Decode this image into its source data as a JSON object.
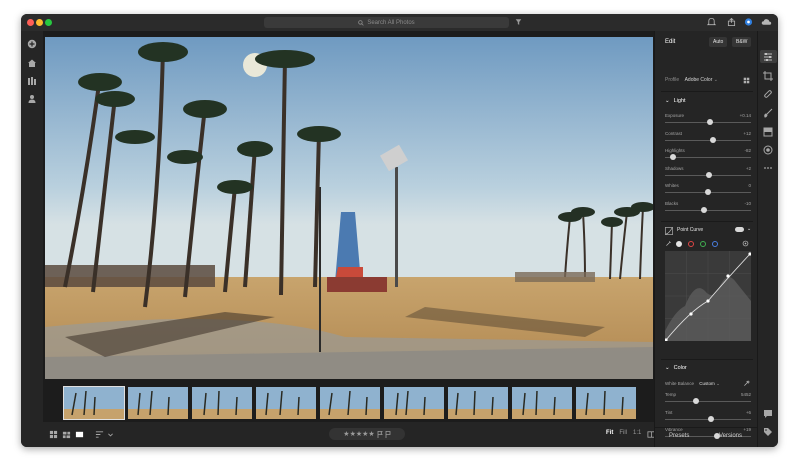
{
  "search": {
    "placeholder": "Search All Photos"
  },
  "edit_panel": {
    "title": "Edit",
    "auto_label": "Auto",
    "bw_label": "B&W",
    "profile_label": "Profile",
    "profile_value": "Adobe Color",
    "light_section": "Light",
    "light_sliders": [
      {
        "label": "Exposure",
        "value": "+0.14",
        "fraction": 0.52
      },
      {
        "label": "Contrast",
        "value": "+12",
        "fraction": 0.56
      },
      {
        "label": "Highlights",
        "value": "-82",
        "fraction": 0.09
      },
      {
        "label": "Shadows",
        "value": "+2",
        "fraction": 0.51
      },
      {
        "label": "Whites",
        "value": "0",
        "fraction": 0.5
      },
      {
        "label": "Blacks",
        "value": "-10",
        "fraction": 0.45
      }
    ],
    "point_curve_label": "Point Curve",
    "color_section": "Color",
    "white_balance_label": "White Balance",
    "white_balance_value": "Custom",
    "color_sliders": [
      {
        "label": "Temp",
        "value": "5452",
        "fraction": 0.36
      },
      {
        "label": "Tint",
        "value": "+6",
        "fraction": 0.53
      },
      {
        "label": "Vibrance",
        "value": "+19",
        "fraction": 0.6
      }
    ]
  },
  "bottom": {
    "fit_label": "Fit",
    "fill_label": "Fill",
    "one_to_one_label": "1:1",
    "presets_label": "Presets",
    "versions_label": "Versions",
    "rating_stars": "★★★★★"
  },
  "colors": {
    "window_bg": "#1e1e1e",
    "panel_bg": "#252525",
    "sky_top": "#7fa7c9",
    "sand": "#c9a56e"
  },
  "icons": {
    "titlebar": [
      "search-icon",
      "filter-icon",
      "notifications-icon",
      "share-icon",
      "help-icon",
      "cloud-icon"
    ],
    "leftrail": [
      "add-photo-icon",
      "home-icon",
      "library-icon",
      "people-icon"
    ],
    "rightrail": [
      "edit-sliders-icon",
      "crop-icon",
      "healing-brush-icon",
      "brush-icon",
      "linear-gradient-icon",
      "radial-gradient-icon",
      "more-icon",
      "comments-icon",
      "tags-icon",
      "info-icon"
    ]
  }
}
